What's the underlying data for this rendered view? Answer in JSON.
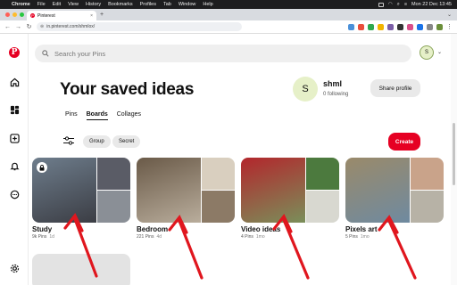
{
  "menubar": {
    "items": [
      "Chrome",
      "File",
      "Edit",
      "View",
      "History",
      "Bookmarks",
      "Profiles",
      "Tab",
      "Window",
      "Help"
    ],
    "datetime": "Mon 22 Dec  13:45"
  },
  "browser": {
    "tab_title": "Pinterest",
    "url": "in.pinterest.com/shmlox/"
  },
  "pinterest": {
    "search_placeholder": "Search your Pins",
    "avatar_initial": "S",
    "page_title": "Your saved ideas",
    "profile": {
      "initial": "S",
      "username": "shml",
      "following": "0 following",
      "share_label": "Share profile"
    },
    "tabs": [
      "Pins",
      "Boards",
      "Collages"
    ],
    "active_tab": "Boards",
    "filters": [
      "Group",
      "Secret"
    ],
    "create_label": "Create",
    "boards": [
      {
        "title": "Study",
        "pins": "9k Pins",
        "time": "1d",
        "secret": true,
        "colors": [
          "#6e7d8c",
          "#3b3d44",
          "#5a5c66",
          "#8a8f96"
        ]
      },
      {
        "title": "Bedroom",
        "pins": "221 Pins",
        "time": "4d",
        "secret": false,
        "colors": [
          "#6a5a48",
          "#b9ad9c",
          "#d9cfbf",
          "#8c7a66"
        ]
      },
      {
        "title": "Video ideas",
        "pins": "4 Pins",
        "time": "1mo",
        "secret": false,
        "colors": [
          "#b3262c",
          "#7a8f5a",
          "#4c7a3e",
          "#d8d8d0"
        ]
      },
      {
        "title": "Pixels art",
        "pins": "5 Pins",
        "time": "1mo",
        "secret": false,
        "colors": [
          "#9a8a6a",
          "#6f8aa0",
          "#c9a38a",
          "#b7b2a6"
        ]
      }
    ]
  },
  "colors": {
    "brand": "#e60023",
    "annotation_arrows": "#e0161e"
  }
}
